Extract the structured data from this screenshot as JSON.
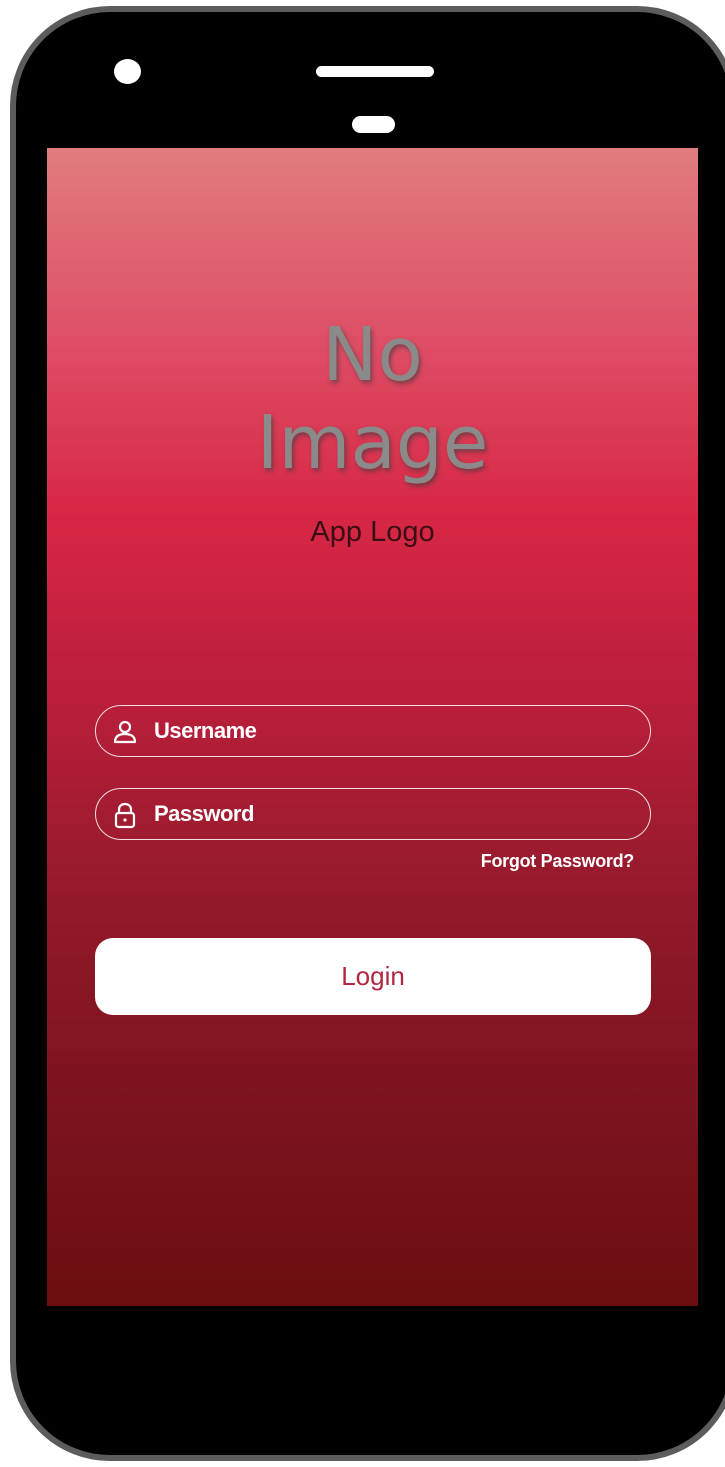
{
  "logo": {
    "placeholder_line1": "No",
    "placeholder_line2": "Image",
    "caption": "App Logo"
  },
  "form": {
    "username": {
      "placeholder": "Username",
      "value": "",
      "icon": "user-icon"
    },
    "password": {
      "placeholder": "Password",
      "value": "",
      "icon": "lock-icon"
    },
    "forgot_password_label": "Forgot Password?",
    "login_label": "Login"
  },
  "colors": {
    "gradient_top": "#e07d7e",
    "gradient_mid": "#d72645",
    "gradient_bottom": "#6c0e10",
    "login_text": "#b3263f",
    "phone_frame": "#5c5c5c"
  }
}
